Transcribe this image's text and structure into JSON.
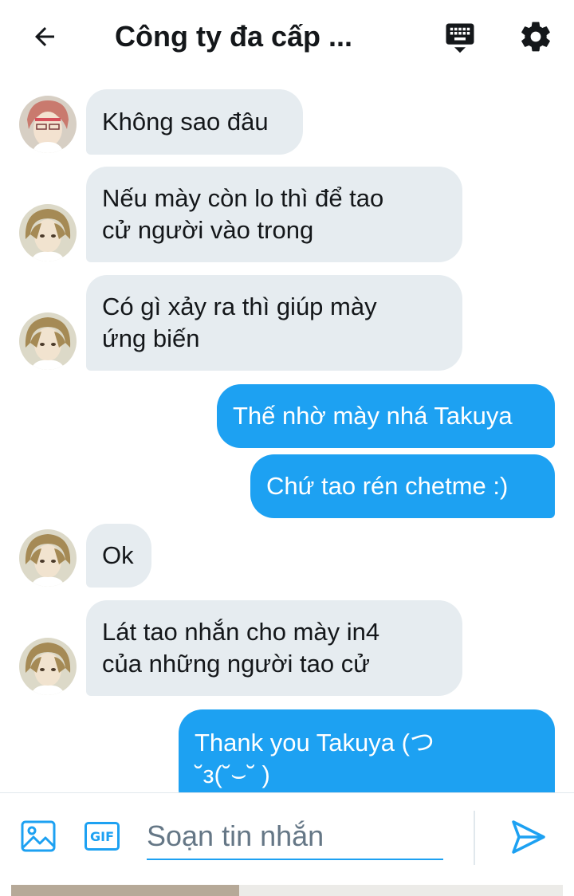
{
  "header": {
    "title": "Công ty đa cấp ..."
  },
  "messages": [
    {
      "side": "in",
      "lines": [
        "Không sao đâu"
      ]
    },
    {
      "side": "in",
      "lines": [
        "Nếu mày còn lo thì để tao",
        "cử người vào trong"
      ]
    },
    {
      "side": "in",
      "lines": [
        "Có gì xảy ra thì giúp mày",
        "ứng biến"
      ]
    },
    {
      "side": "out",
      "lines": [
        "Thế nhờ mày nhá Takuya"
      ]
    },
    {
      "side": "out",
      "lines": [
        "Chứ tao rén chetme :)"
      ]
    },
    {
      "side": "in",
      "lines": [
        "Ok"
      ]
    },
    {
      "side": "in",
      "lines": [
        "Lát tao nhắn cho mày in4",
        "của những người tao cử"
      ]
    },
    {
      "side": "out",
      "lines": [
        "Thank you Takuya (つ",
        "˘з(˘⌣˘ )"
      ]
    }
  ],
  "composer": {
    "gif_label": "GIF",
    "placeholder": "Soạn tin nhắn"
  },
  "icons": {
    "back": "arrow-left-icon",
    "keyboard": "keyboard-icon",
    "settings": "gear-icon",
    "image": "image-icon",
    "send": "send-icon"
  },
  "colors": {
    "accent": "#1da1f2",
    "incoming_bubble": "#e6ecf0",
    "text": "#14171a",
    "placeholder": "#657786"
  }
}
